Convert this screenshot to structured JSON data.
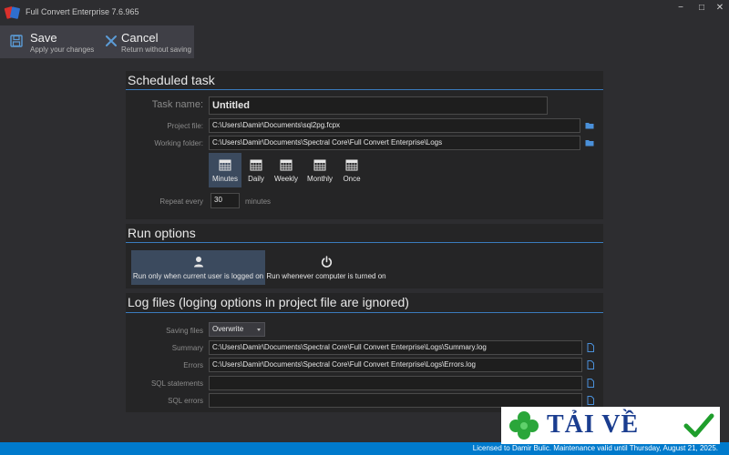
{
  "window": {
    "title": "Full Convert Enterprise 7.6.965",
    "minimize": "−",
    "maximize": "□",
    "close": "✕"
  },
  "toolbar": {
    "save": {
      "label": "Save",
      "sub": "Apply your changes",
      "icon": "save-icon"
    },
    "cancel": {
      "label": "Cancel",
      "sub": "Return without saving",
      "icon": "close-icon"
    }
  },
  "scheduled": {
    "title": "Scheduled task",
    "task_name_label": "Task name:",
    "task_name_value": "Untitled",
    "project_file_label": "Project file:",
    "project_file_value": "C:\\Users\\Damir\\Documents\\sql2pg.fcpx",
    "working_folder_label": "Working folder:",
    "working_folder_value": "C:\\Users\\Damir\\Documents\\Spectral Core\\Full Convert Enterprise\\Logs",
    "schedules": [
      "Minutes",
      "Daily",
      "Weekly",
      "Monthly",
      "Once"
    ],
    "selected_schedule": "Minutes",
    "repeat_label": "Repeat every",
    "repeat_value": "30",
    "repeat_unit": "minutes"
  },
  "run": {
    "title": "Run options",
    "option_user": "Run only when current user is logged on",
    "option_computer": "Run whenever computer is turned on",
    "selected": "option_user"
  },
  "logs": {
    "title": "Log files (loging options in project file are ignored)",
    "saving_label": "Saving files",
    "saving_value": "Overwrite",
    "summary_label": "Summary",
    "summary_value": "C:\\Users\\Damir\\Documents\\Spectral Core\\Full Convert Enterprise\\Logs\\Summary.log",
    "errors_label": "Errors",
    "errors_value": "C:\\Users\\Damir\\Documents\\Spectral Core\\Full Convert Enterprise\\Logs\\Errors.log",
    "sql_statements_label": "SQL statements",
    "sql_statements_value": "",
    "sql_errors_label": "SQL errors",
    "sql_errors_value": ""
  },
  "status": {
    "text": "Licensed to Damir Bulic. Maintenance valid until Thursday, August 21, 2025."
  },
  "watermark": {
    "text": "TẢI VỀ"
  },
  "colors": {
    "background": "#2d2d30",
    "panel": "#252526",
    "accent": "#3a7bbd",
    "status_bar": "#007acc",
    "selected": "#3b4a5e"
  }
}
